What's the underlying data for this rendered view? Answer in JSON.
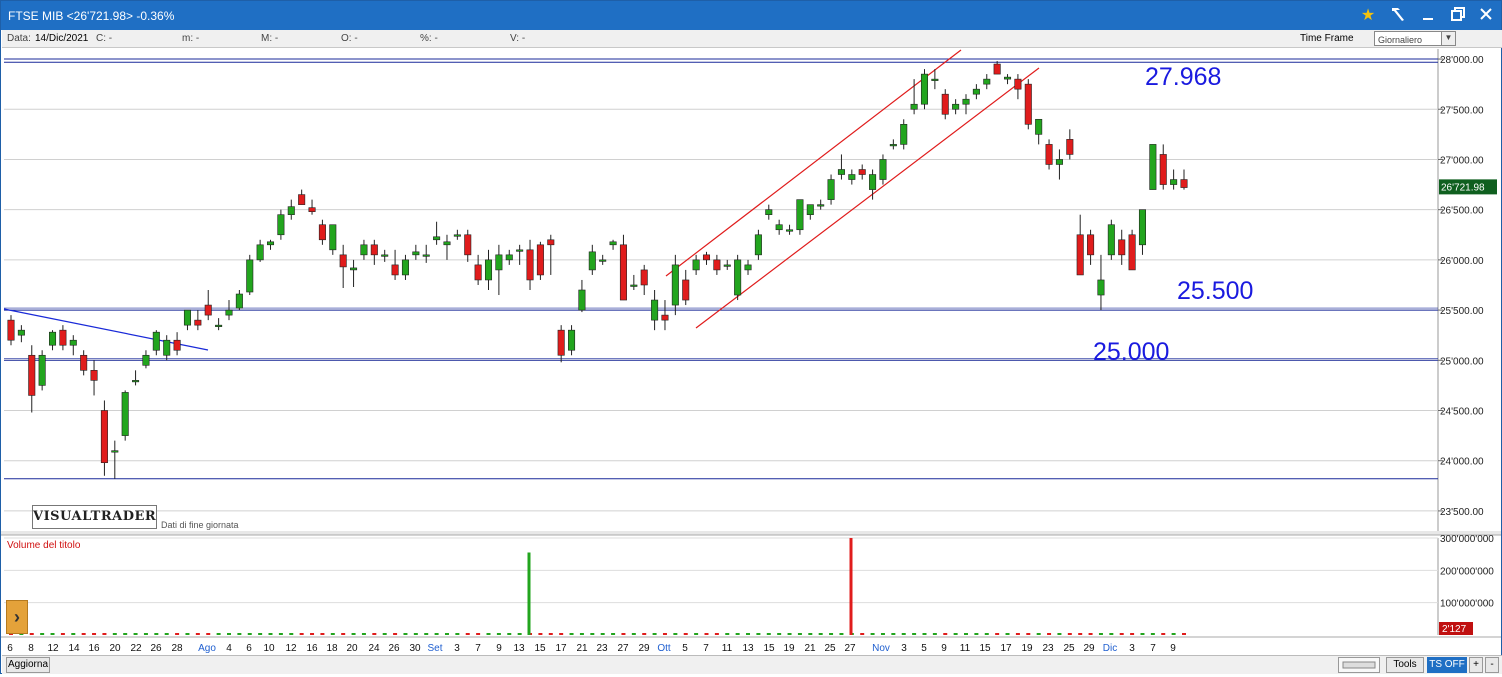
{
  "window": {
    "title": "FTSE MIB  <26'721.98>  -0.36%",
    "icons": [
      "star-icon",
      "hammer-icon",
      "minimize-icon",
      "restore-icon",
      "close-icon"
    ]
  },
  "infobar": {
    "data_label": "Data:",
    "date": "14/Dic/2021",
    "c": "C: -",
    "m": "m: -",
    "M": "M: -",
    "O": "O: -",
    "pct": "%: -",
    "V": "V: -",
    "timeframe_label": "Time Frame",
    "timeframe_value": "Giornaliero"
  },
  "branding": {
    "logo": "VISUALTRADER",
    "subtitle": "Dati di fine giornata"
  },
  "volume_panel": {
    "label": "Volume del titolo",
    "last_value_badge": "2'127"
  },
  "bottombar": {
    "refresh": "Aggiorna",
    "tools": "Tools",
    "ts": "TS OFF",
    "plus": "+",
    "minus": "-"
  },
  "colors": {
    "up": "#22a51e",
    "down": "#e01c1c",
    "annotation": "#1a1adf",
    "support": "#1a2a9a",
    "channel": "#e01c1c",
    "titlebar": "#1f6fc4"
  },
  "chart_data": {
    "type": "candlestick",
    "ylim": [
      23300,
      28100
    ],
    "y_ticks": [
      "23'500.00",
      "24'000.00",
      "24'500.00",
      "25'000.00",
      "25'500.00",
      "26'000.00",
      "26'500.00",
      "27'000.00",
      "27'500.00",
      "28'000.00"
    ],
    "y_tick_values": [
      23500,
      24000,
      24500,
      25000,
      25500,
      26000,
      26500,
      27000,
      27500,
      28000
    ],
    "last_price_label": "26'721.98",
    "last_price": 26721.98,
    "x_labels": [
      "6",
      "8",
      "12",
      "14",
      "16",
      "20",
      "22",
      "26",
      "28",
      "Ago",
      "4",
      "6",
      "10",
      "12",
      "16",
      "18",
      "20",
      "24",
      "26",
      "30",
      "Set",
      "3",
      "7",
      "9",
      "13",
      "15",
      "17",
      "21",
      "23",
      "27",
      "29",
      "Ott",
      "5",
      "7",
      "11",
      "13",
      "15",
      "19",
      "21",
      "25",
      "27",
      "Nov",
      "3",
      "5",
      "9",
      "11",
      "15",
      "17",
      "19",
      "23",
      "25",
      "29",
      "Dic",
      "3",
      "7",
      "9"
    ],
    "month_labels": [
      "Ago",
      "Set",
      "Ott",
      "Nov",
      "Dic"
    ],
    "candles": [
      [
        25400,
        25450,
        25150,
        25200
      ],
      [
        25250,
        25350,
        25180,
        25300
      ],
      [
        25050,
        25150,
        24480,
        24650
      ],
      [
        24750,
        25100,
        24700,
        25050
      ],
      [
        25150,
        25300,
        25100,
        25280
      ],
      [
        25300,
        25350,
        25100,
        25150
      ],
      [
        25150,
        25250,
        25050,
        25200
      ],
      [
        25050,
        25100,
        24850,
        24900
      ],
      [
        24900,
        25000,
        24650,
        24800
      ],
      [
        24500,
        24600,
        23850,
        23980
      ],
      [
        24100,
        24200,
        23820,
        24100
      ],
      [
        24250,
        24700,
        24200,
        24680
      ],
      [
        24800,
        24900,
        24750,
        24800
      ],
      [
        24950,
        25100,
        24920,
        25050
      ],
      [
        25100,
        25300,
        25050,
        25280
      ],
      [
        25050,
        25250,
        25000,
        25200
      ],
      [
        25200,
        25280,
        25050,
        25100
      ],
      [
        25350,
        25500,
        25300,
        25500
      ],
      [
        25400,
        25500,
        25300,
        25350
      ],
      [
        25550,
        25700,
        25400,
        25450
      ],
      [
        25350,
        25420,
        25300,
        25350
      ],
      [
        25450,
        25600,
        25400,
        25500
      ],
      [
        25520,
        25700,
        25500,
        25660
      ],
      [
        25680,
        26050,
        25650,
        26000
      ],
      [
        26000,
        26200,
        25980,
        26150
      ],
      [
        26150,
        26200,
        26100,
        26180
      ],
      [
        26250,
        26500,
        26200,
        26450
      ],
      [
        26450,
        26600,
        26400,
        26530
      ],
      [
        26650,
        26700,
        26550,
        26550
      ],
      [
        26520,
        26600,
        26450,
        26480
      ],
      [
        26350,
        26400,
        26150,
        26200
      ],
      [
        26100,
        26350,
        26050,
        26350
      ],
      [
        26050,
        26150,
        25720,
        25930
      ],
      [
        25900,
        26000,
        25730,
        25920
      ],
      [
        26050,
        26200,
        26000,
        26150
      ],
      [
        26150,
        26200,
        25950,
        26050
      ],
      [
        26050,
        26100,
        25980,
        26050
      ],
      [
        25950,
        26100,
        25800,
        25850
      ],
      [
        25850,
        26050,
        25800,
        26000
      ],
      [
        26050,
        26150,
        26000,
        26080
      ],
      [
        26050,
        26150,
        25970,
        26050
      ],
      [
        26200,
        26380,
        26150,
        26230
      ],
      [
        26150,
        26250,
        26000,
        26180
      ],
      [
        26250,
        26300,
        26200,
        26250
      ],
      [
        26250,
        26300,
        25980,
        26050
      ],
      [
        25950,
        26050,
        25750,
        25800
      ],
      [
        25800,
        26100,
        25700,
        26000
      ],
      [
        25900,
        26150,
        25650,
        26050
      ],
      [
        26000,
        26100,
        25950,
        26050
      ],
      [
        26100,
        26150,
        25950,
        26100
      ],
      [
        26100,
        26200,
        25700,
        25800
      ],
      [
        26150,
        26180,
        25800,
        25850
      ],
      [
        26200,
        26250,
        25850,
        26150
      ],
      [
        25300,
        25350,
        24980,
        25050
      ],
      [
        25100,
        25350,
        25050,
        25300
      ],
      [
        25500,
        25800,
        25480,
        25700
      ],
      [
        25900,
        26150,
        25850,
        26080
      ],
      [
        26000,
        26050,
        25950,
        26000
      ],
      [
        26150,
        26200,
        26100,
        26180
      ],
      [
        26150,
        26250,
        25600,
        25600
      ],
      [
        25750,
        25850,
        25700,
        25750
      ],
      [
        25900,
        25950,
        25650,
        25750
      ],
      [
        25400,
        25700,
        25300,
        25600
      ],
      [
        25450,
        25600,
        25300,
        25400
      ],
      [
        25550,
        26050,
        25450,
        25950
      ],
      [
        25800,
        25900,
        25550,
        25600
      ],
      [
        25900,
        26050,
        25850,
        26000
      ],
      [
        26050,
        26080,
        25950,
        26000
      ],
      [
        26000,
        26050,
        25850,
        25900
      ],
      [
        25950,
        26000,
        25900,
        25950
      ],
      [
        25650,
        26050,
        25600,
        26000
      ],
      [
        25900,
        26000,
        25850,
        25950
      ],
      [
        26050,
        26300,
        26000,
        26250
      ],
      [
        26450,
        26550,
        26400,
        26500
      ],
      [
        26300,
        26400,
        26250,
        26350
      ],
      [
        26300,
        26350,
        26250,
        26300
      ],
      [
        26300,
        26600,
        26250,
        26600
      ],
      [
        26450,
        26550,
        26400,
        26550
      ],
      [
        26550,
        26600,
        26500,
        26550
      ],
      [
        26600,
        26850,
        26550,
        26800
      ],
      [
        26850,
        27050,
        26800,
        26900
      ],
      [
        26800,
        26900,
        26750,
        26850
      ],
      [
        26900,
        26950,
        26800,
        26850
      ],
      [
        26700,
        26900,
        26600,
        26850
      ],
      [
        26800,
        27050,
        26750,
        27000
      ],
      [
        27150,
        27200,
        27100,
        27150
      ],
      [
        27150,
        27400,
        27100,
        27350
      ],
      [
        27500,
        27800,
        27450,
        27550
      ],
      [
        27550,
        27900,
        27500,
        27850
      ],
      [
        27800,
        27900,
        27700,
        27800
      ],
      [
        27650,
        27700,
        27400,
        27450
      ],
      [
        27500,
        27600,
        27450,
        27550
      ],
      [
        27550,
        27650,
        27450,
        27600
      ],
      [
        27650,
        27750,
        27600,
        27700
      ],
      [
        27750,
        27850,
        27700,
        27800
      ],
      [
        27950,
        27980,
        27850,
        27850
      ],
      [
        27800,
        27850,
        27750,
        27820
      ],
      [
        27800,
        27850,
        27600,
        27700
      ],
      [
        27750,
        27800,
        27300,
        27350
      ],
      [
        27250,
        27400,
        27150,
        27400
      ],
      [
        27150,
        27200,
        26900,
        26950
      ],
      [
        26950,
        27100,
        26800,
        27000
      ],
      [
        27200,
        27300,
        27000,
        27050
      ],
      [
        26250,
        26450,
        25850,
        25850
      ],
      [
        26250,
        26300,
        25950,
        26050
      ],
      [
        25650,
        26050,
        25500,
        25800
      ],
      [
        26050,
        26400,
        26000,
        26350
      ],
      [
        26200,
        26300,
        25950,
        26050
      ],
      [
        26250,
        26300,
        25900,
        25900
      ],
      [
        26150,
        26500,
        26050,
        26500
      ],
      [
        26700,
        27150,
        26700,
        27150
      ],
      [
        27050,
        27150,
        26700,
        26750
      ],
      [
        26750,
        26900,
        26700,
        26800
      ],
      [
        26800,
        26900,
        26700,
        26720
      ]
    ],
    "volume": {
      "ylim": [
        0,
        300000000
      ],
      "y_ticks": [
        "100'000'000",
        "200'000'000",
        "300'000'000"
      ],
      "y_tick_values": [
        100000000,
        200000000,
        300000000
      ],
      "spikes": [
        {
          "date": "14 Set",
          "value": 255000000,
          "direction": "up"
        },
        {
          "date": "27 Ott",
          "value": 300000000,
          "direction": "down"
        }
      ]
    },
    "annotations": [
      {
        "text": "27.968",
        "price": 27968
      },
      {
        "text": "25.500",
        "price": 25500
      },
      {
        "text": "25.000",
        "price": 25000
      }
    ],
    "horizontal_levels": [
      28000,
      27968,
      25500,
      25000,
      23820
    ],
    "trendlines": [
      {
        "name": "downtrend",
        "from": [
          "6",
          25480
        ],
        "to": [
          "Ago",
          25120
        ]
      },
      {
        "name": "channel-upper",
        "from": [
          "Ott",
          25850
        ],
        "to": [
          "15 Nov",
          28100
        ]
      },
      {
        "name": "channel-lower",
        "from": [
          "5 Ott",
          25320
        ],
        "to": [
          "19 Nov",
          27900
        ]
      }
    ]
  }
}
